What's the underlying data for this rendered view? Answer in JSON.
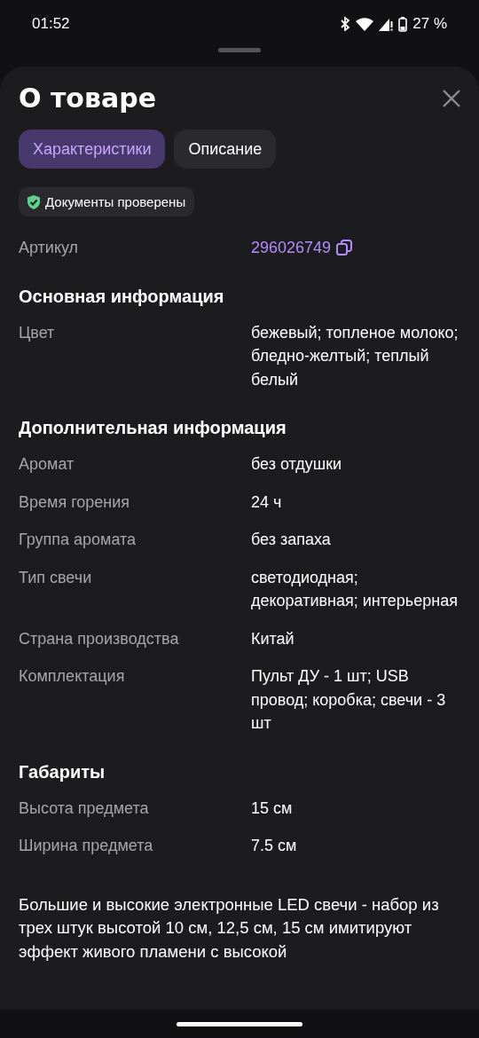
{
  "status_bar": {
    "time": "01:52",
    "battery": "27 %"
  },
  "sheet": {
    "title": "О товаре"
  },
  "tabs": [
    {
      "label": "Характеристики",
      "selected": true
    },
    {
      "label": "Описание",
      "selected": false
    }
  ],
  "badge": {
    "label": "Документы проверены"
  },
  "article": {
    "label": "Артикул",
    "value": "296026749"
  },
  "sections": [
    {
      "title": "Основная информация",
      "rows": [
        {
          "label": "Цвет",
          "value": "бежевый; топленое молоко; бледно-желтый; теплый белый"
        }
      ]
    },
    {
      "title": "Дополнительная информация",
      "rows": [
        {
          "label": "Аромат",
          "value": "без отдушки"
        },
        {
          "label": "Время горения",
          "value": "24 ч"
        },
        {
          "label": "Группа аромата",
          "value": "без запаха"
        },
        {
          "label": "Тип свечи",
          "value": "светодиодная; декоративная; интерьерная"
        },
        {
          "label": "Страна производства",
          "value": "Китай"
        },
        {
          "label": "Комплектация",
          "value": "Пульт ДУ - 1 шт; USB провод; коробка; свечи - 3 шт"
        }
      ]
    },
    {
      "title": "Габариты",
      "rows": [
        {
          "label": "Высота предмета",
          "value": "15 см"
        },
        {
          "label": "Ширина предмета",
          "value": "7.5 см"
        }
      ]
    }
  ],
  "description": "Большие и высокие электронные LED свечи - набор из трех штук высотой 10 см, 12,5 см, 15 см имитируют эффект живого пламени с высокой"
}
